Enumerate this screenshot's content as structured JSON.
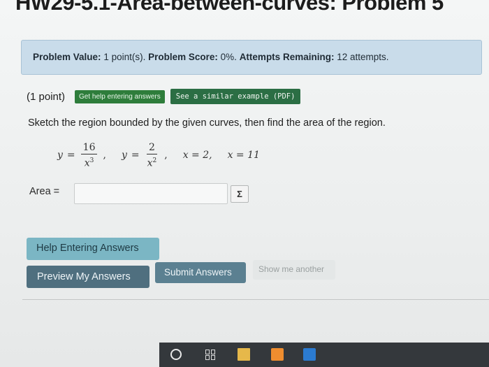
{
  "page": {
    "title": "HW29-5.1-Area-between-curves: Problem 5"
  },
  "info_bar": {
    "value_label": "Problem Value:",
    "value_text": "1 point(s).",
    "score_label": "Problem Score:",
    "score_text": "0%.",
    "attempts_label": "Attempts Remaining:",
    "attempts_text": "12 attempts."
  },
  "problem": {
    "points": "(1 point)",
    "help_link": "Get help entering answers",
    "similar_link": "See a similar example (PDF)",
    "instruction": "Sketch the region bounded by the given curves, then find the area of the region.",
    "eq1_lhs": "y",
    "eq1_num": "16",
    "eq1_den_var": "x",
    "eq1_den_exp": "3",
    "eq2_lhs": "y",
    "eq2_num": "2",
    "eq2_den_var": "x",
    "eq2_den_exp": "2",
    "eq3": "x = 2,",
    "eq4": "x = 11"
  },
  "answer": {
    "label": "Area =",
    "value": "",
    "equation_editor_symbol": "Σ"
  },
  "buttons": {
    "help_entering": "Help Entering Answers",
    "preview": "Preview My Answers",
    "submit": "Submit Answers",
    "show_another": "Show me another"
  },
  "taskbar": {
    "icons": [
      "search-icon",
      "task-view-icon",
      "file-explorer-icon",
      "store-icon",
      "mail-icon"
    ]
  }
}
